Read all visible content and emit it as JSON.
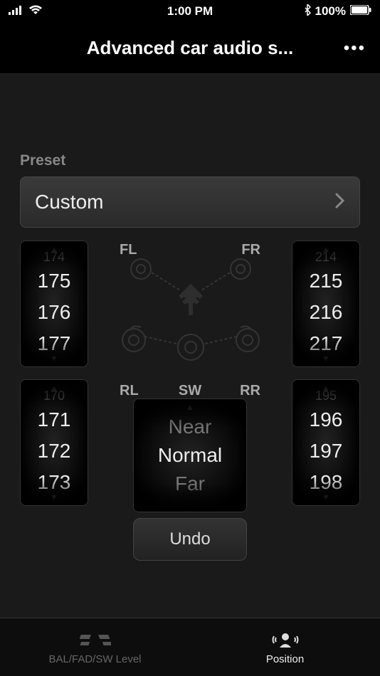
{
  "status": {
    "time": "1:00 PM",
    "battery": "100%"
  },
  "nav": {
    "title": "Advanced car audio s..."
  },
  "preset": {
    "label": "Preset",
    "value": "Custom"
  },
  "speakers": {
    "fl": {
      "label": "FL",
      "values": [
        "174",
        "175",
        "176",
        "177"
      ],
      "faded_bottom": ""
    },
    "fr": {
      "label": "FR",
      "values": [
        "214",
        "215",
        "216",
        "217"
      ],
      "faded_bottom": ""
    },
    "rl": {
      "label": "RL",
      "values": [
        "170",
        "171",
        "172",
        "173"
      ],
      "faded_bottom": ""
    },
    "rr": {
      "label": "RR",
      "values": [
        "195",
        "196",
        "197",
        "198"
      ],
      "faded_bottom": ""
    },
    "sw": {
      "label": "SW",
      "values": [
        "Near",
        "Normal",
        "Far"
      ]
    }
  },
  "undo": {
    "label": "Undo"
  },
  "tabs": {
    "left": {
      "label": "BAL/FAD/SW Level"
    },
    "right": {
      "label": "Position"
    }
  }
}
